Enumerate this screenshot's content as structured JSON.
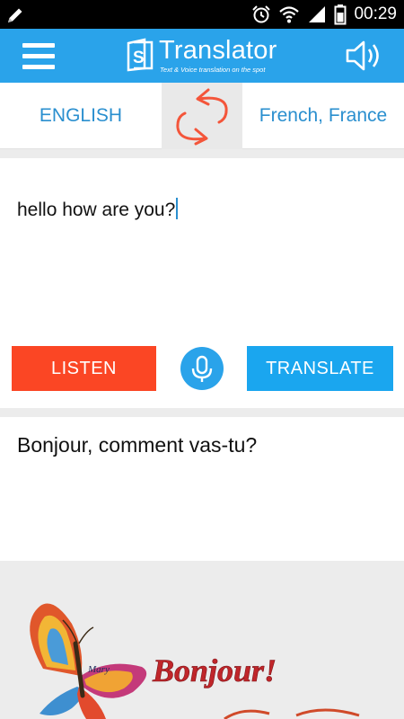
{
  "status_bar": {
    "time": "00:29",
    "icons": [
      "pencil-icon",
      "alarm-icon",
      "wifi-icon",
      "signal-icon",
      "battery-icon"
    ]
  },
  "app_bar": {
    "title": "Translator",
    "subtitle": "Text & Voice translation on the spot",
    "menu_icon": "hamburger-menu-icon",
    "speaker_icon": "speaker-icon",
    "color": "#2aa3ea"
  },
  "languages": {
    "source": "ENGLISH",
    "target": "French, France",
    "swap_icon": "swap-arrows-icon"
  },
  "input": {
    "text": "hello how are you?"
  },
  "actions": {
    "listen_label": "LISTEN",
    "translate_label": "TRANSLATE",
    "mic_icon": "microphone-icon",
    "listen_color": "#fb4624",
    "translate_color": "#1aa6ef"
  },
  "output": {
    "text": "Bonjour, comment vas-tu?"
  },
  "banner": {
    "text": "Bonjour!",
    "signature": "Mary"
  }
}
